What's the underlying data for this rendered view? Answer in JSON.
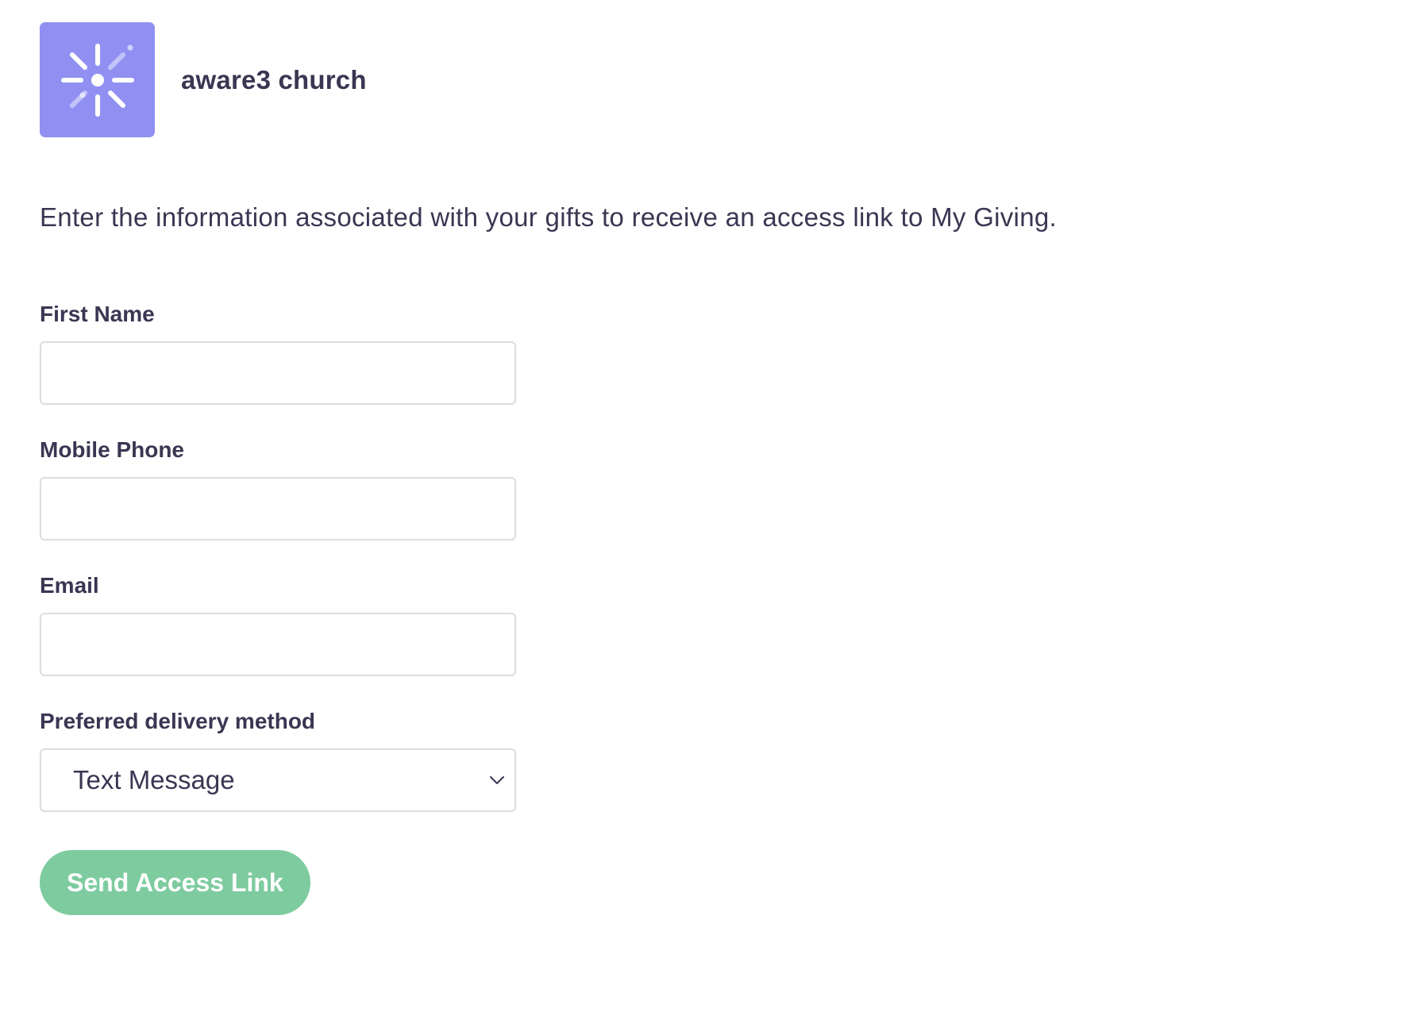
{
  "organization": {
    "name": "aware3 church",
    "logo_icon": "starburst-icon",
    "logo_color": "#9190f2"
  },
  "intro_text": "Enter the information associated with your gifts to receive an access link to My Giving.",
  "form": {
    "first_name": {
      "label": "First Name",
      "value": "",
      "placeholder": ""
    },
    "mobile_phone": {
      "label": "Mobile Phone",
      "value": "",
      "placeholder": ""
    },
    "email": {
      "label": "Email",
      "value": "",
      "placeholder": ""
    },
    "delivery_method": {
      "label": "Preferred delivery method",
      "selected": "Text Message",
      "icon": "chevron-down-icon"
    },
    "submit_label": "Send Access Link",
    "submit_color": "#7ecb9f"
  },
  "colors": {
    "text": "#3a3652",
    "input_border": "#dcdce3",
    "background": "#ffffff"
  }
}
